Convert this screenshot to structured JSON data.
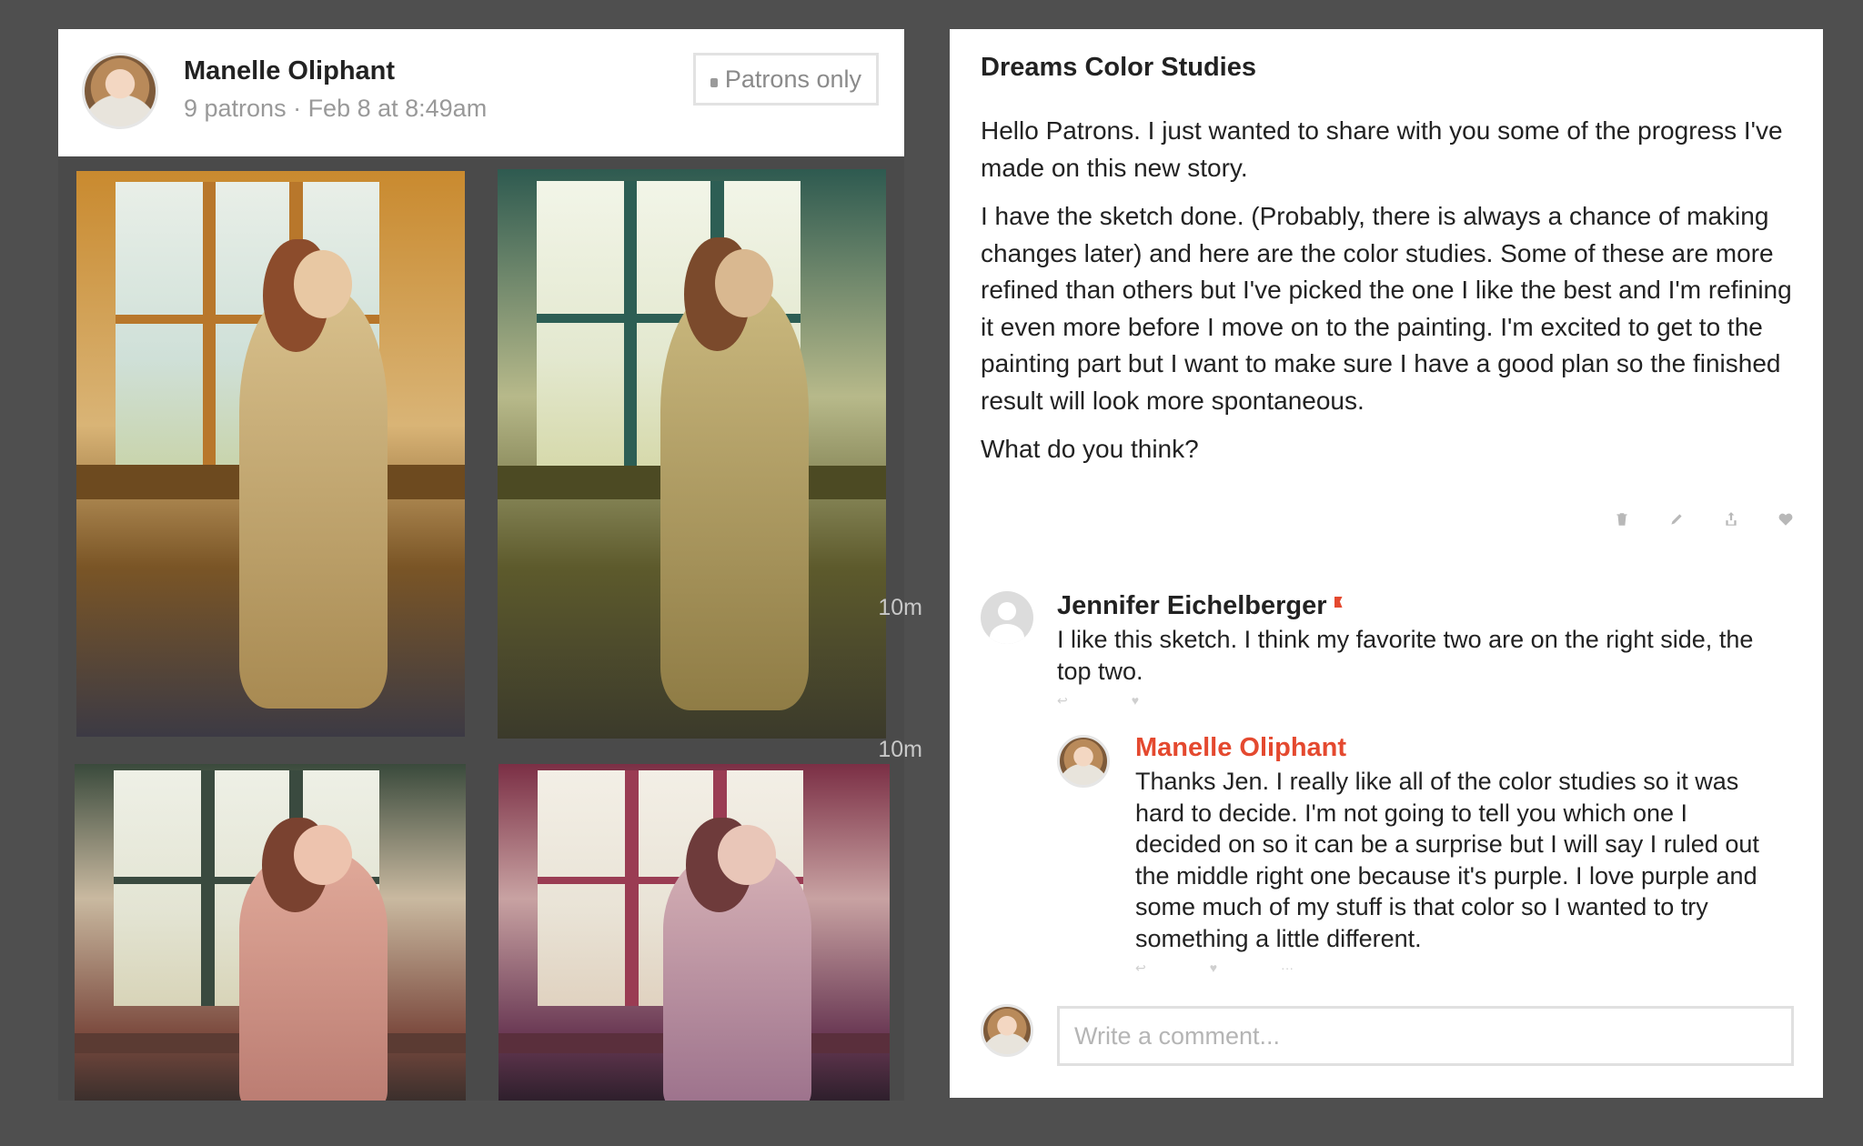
{
  "post": {
    "author_name": "Manelle Oliphant",
    "meta": "9 patrons · Feb 8 at 8:49am",
    "access_label": "Patrons only",
    "title": "Dreams Color Studies",
    "body": [
      "Hello Patrons. I just wanted to share with you some of the progress I've made on this new story.",
      "I have the sketch done. (Probably, there is always a chance of making changes later) and here are the color studies. Some of these are more refined than others but I've picked the one I like the best and I'm refining it even more before I move on to the painting. I'm excited to get to the painting part but I want to make sure I have a good plan so the finished result will look more spontaneous.",
      "What do you think?"
    ],
    "actions": [
      "trash-icon",
      "pencil-icon",
      "share-icon",
      "heart-icon"
    ],
    "images": [
      "color-study-golden",
      "color-study-green",
      "color-study-rose",
      "color-study-magenta"
    ]
  },
  "comments": [
    {
      "name": "Jennifer Eichelberger",
      "time": "10m",
      "text": "I like this sketch. I think my favorite two are on the right side, the top two."
    },
    {
      "name": "Manelle Oliphant",
      "time": "10m",
      "text": "Thanks Jen. I really like all of the color studies so it was hard to decide. I'm not going to tell you which one I decided on so it can be a surprise but I will say I ruled out the middle right one because it's purple. I love purple and some much of my stuff is that color so I wanted to try something a little different."
    }
  ],
  "comment_input": {
    "placeholder": "Write a comment..."
  },
  "colors": {
    "creator_accent": "#e4492f",
    "background": "#4f4f4f"
  }
}
